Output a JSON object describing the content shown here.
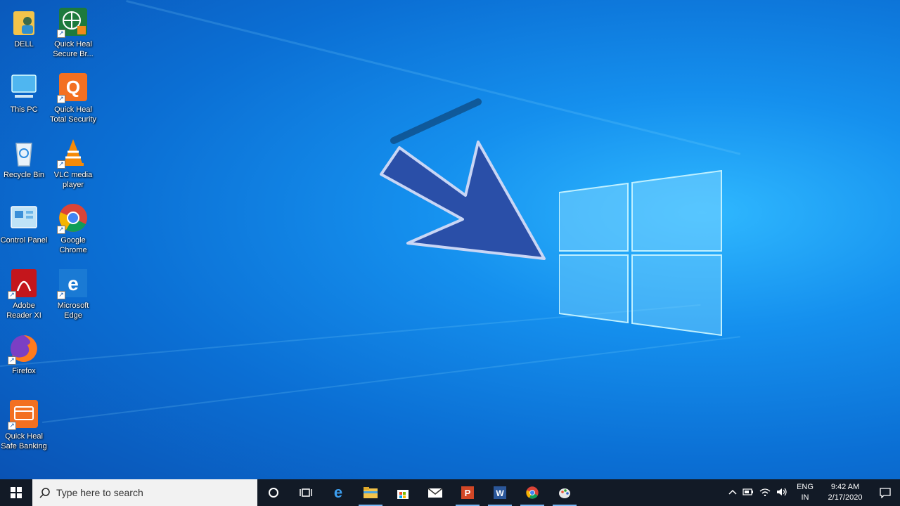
{
  "desktop": {
    "icons": [
      {
        "name": "DELL",
        "icon": "user-folder-icon"
      },
      {
        "name": "Quick Heal Secure Br...",
        "icon": "quick-heal-browser-icon"
      },
      {
        "name": "This PC",
        "icon": "computer-icon"
      },
      {
        "name": "Quick Heal Total Security",
        "icon": "quick-heal-icon"
      },
      {
        "name": "Recycle Bin",
        "icon": "recycle-bin-icon"
      },
      {
        "name": "VLC media player",
        "icon": "vlc-icon"
      },
      {
        "name": "Control Panel",
        "icon": "control-panel-icon"
      },
      {
        "name": "Google Chrome",
        "icon": "chrome-icon"
      },
      {
        "name": "Adobe Reader XI",
        "icon": "adobe-reader-icon"
      },
      {
        "name": "Microsoft Edge",
        "icon": "edge-icon"
      },
      {
        "name": "Firefox",
        "icon": "firefox-icon"
      },
      {
        "name": "Quick Heal Safe Banking",
        "icon": "safe-banking-icon"
      }
    ]
  },
  "taskbar": {
    "search_placeholder": "Type here to search",
    "pinned": [
      "cortana-icon",
      "task-view-icon",
      "edge-icon",
      "file-explorer-icon",
      "store-icon",
      "mail-icon",
      "powerpoint-icon",
      "word-icon",
      "chrome-icon",
      "paint-icon"
    ],
    "tray": {
      "lang_top": "ENG",
      "lang_bottom": "IN",
      "time": "9:42 AM",
      "date": "2/17/2020"
    }
  },
  "colors": {
    "taskbar": "#121a26",
    "accent": "#0b6fd4"
  }
}
